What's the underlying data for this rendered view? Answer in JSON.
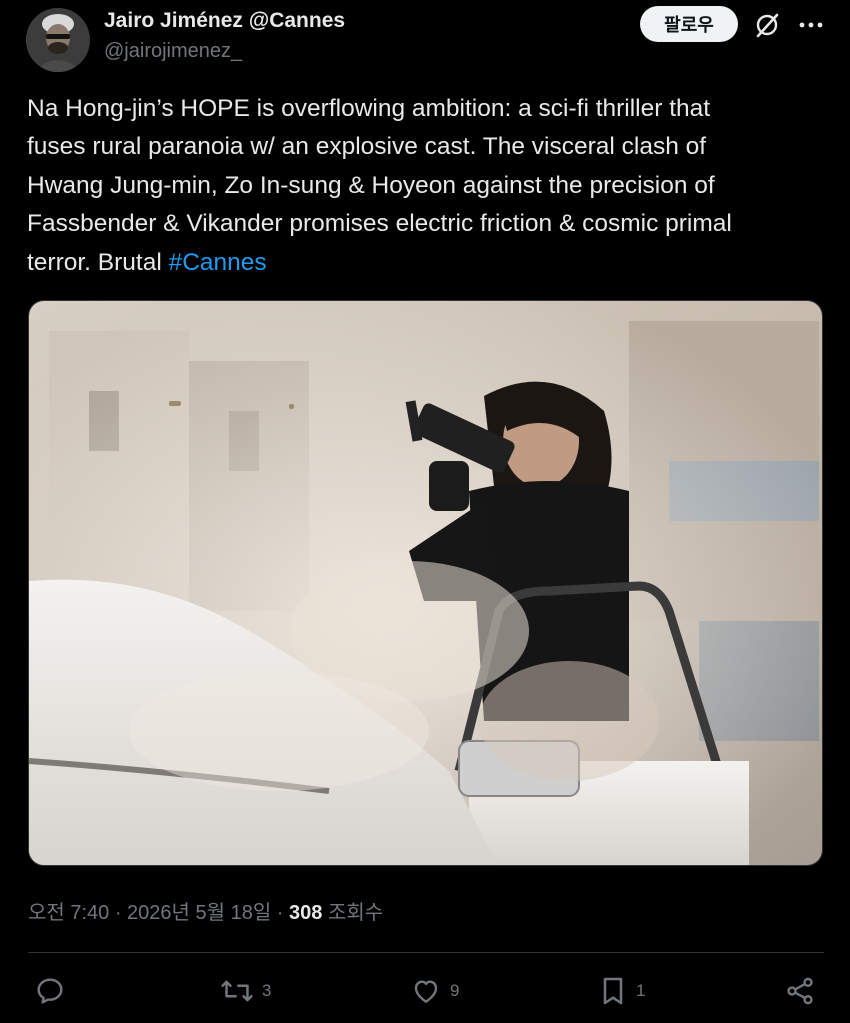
{
  "tweet": {
    "author": {
      "name": "Jairo Jiménez @Cannes",
      "handle": "@jairojimenez_"
    },
    "follow_label": "팔로우",
    "text_lines": [
      "Na Hong-jin’s HOPE is overflowing ambition: a sci-fi thriller that",
      "fuses rural paranoia w/ an explosive cast. The visceral clash of",
      "Hwang Jung-min, Zo In-sung & Hoyeon against the precision of",
      "Fassbender & Vikander promises electric friction & cosmic primal",
      "terror. Brutal "
    ],
    "hashtag": "#Cannes",
    "timestamp": "오전 7:40 · 2026년 5월 18일 · ",
    "views_count": "308",
    "views_label": " 조회수",
    "actions": {
      "reply_count": "",
      "retweet_count": "3",
      "like_count": "9",
      "bookmark_count": "1"
    }
  },
  "icons": {
    "grok": "grok-icon",
    "more": "more-dots-icon",
    "reply": "reply-bubble-icon",
    "retweet": "retweet-icon",
    "like": "heart-icon",
    "bookmark": "bookmark-icon",
    "share": "share-icon"
  },
  "colors": {
    "background": "#000000",
    "text": "#e7e9ea",
    "secondary": "#71767b",
    "accent": "#1d9bf0",
    "divider": "#2f3336"
  }
}
